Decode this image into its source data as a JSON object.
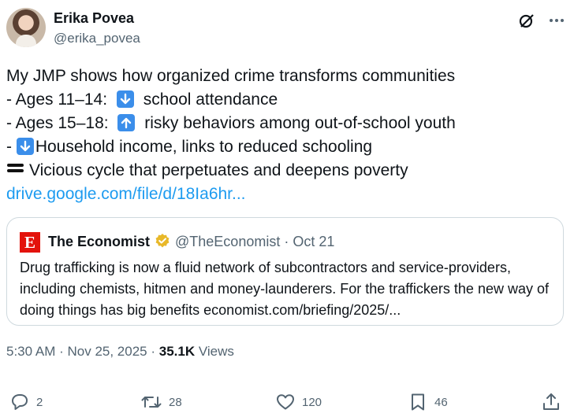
{
  "author": {
    "name": "Erika Povea",
    "handle": "@erika_povea"
  },
  "post": {
    "intro": "My JMP shows how organized crime transforms communities",
    "line1_prefix": "- Ages 11–14: ",
    "line1_text": " school attendance",
    "line2_prefix": "- Ages 15–18: ",
    "line2_text": " risky behaviors among out-of-school youth",
    "line3_prefix": "- ",
    "line3_text": "Household income, links to reduced schooling",
    "line4_text": "Vicious cycle that perpetuates and deepens poverty",
    "link_text": "drive.google.com/file/d/18Ia6hr..."
  },
  "quote": {
    "logo_letter": "E",
    "name": "The Economist",
    "handle": "@TheEconomist",
    "separator": "·",
    "date": "Oct 21",
    "text": "Drug trafficking is now a fluid network of subcontractors and service-providers, including chemists, hitmen and money-launderers. For the traffickers the new way of doing things has big benefits economist.com/briefing/2025/..."
  },
  "meta": {
    "time": "5:30 AM",
    "separator": " · ",
    "date": "Nov 25, 2025",
    "separator2": " · ",
    "views_count": "35.1K",
    "views_label": " Views"
  },
  "actions": {
    "replies": "2",
    "reposts": "28",
    "likes": "120",
    "bookmarks": "46"
  },
  "colors": {
    "accent": "#1d9bf0",
    "text": "#0f1419",
    "muted": "#536471",
    "border": "#cfd9de",
    "economist_red": "#e3120b"
  },
  "icons": [
    "grok-icon",
    "more-icon",
    "arrow-down-icon",
    "arrow-up-icon",
    "equals-icon",
    "verified-badge-icon",
    "reply-icon",
    "repost-icon",
    "like-icon",
    "bookmark-icon",
    "share-icon"
  ]
}
